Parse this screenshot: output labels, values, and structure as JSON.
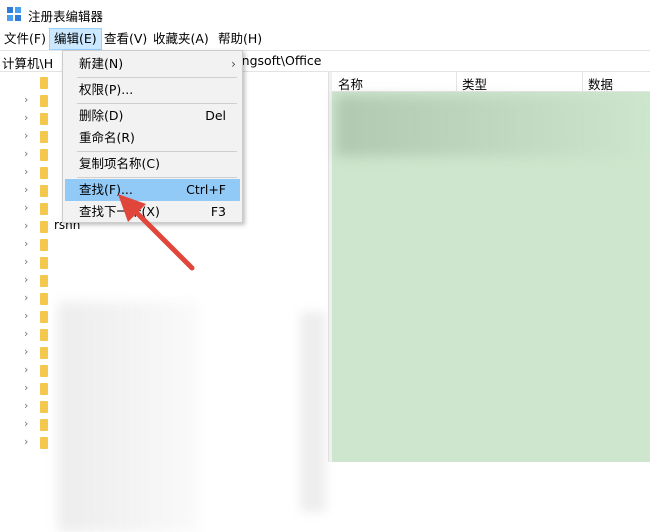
{
  "window": {
    "title": "注册表编辑器",
    "icon": "registry-editor-icon"
  },
  "menubar": {
    "items": [
      {
        "label": "文件(F)"
      },
      {
        "label": "编辑(E)"
      },
      {
        "label": "查看(V)"
      },
      {
        "label": "收藏夹(A)"
      },
      {
        "label": "帮助(H)"
      }
    ]
  },
  "address": {
    "left": "计算机\\H",
    "right": "Kingsoft\\Office"
  },
  "tree": {
    "visible_label": "rsnn"
  },
  "list": {
    "columns": [
      {
        "label": "名称"
      },
      {
        "label": "类型"
      },
      {
        "label": "数据"
      }
    ]
  },
  "edit_menu": {
    "items": [
      {
        "label": "新建(N)",
        "shortcut": "",
        "submenu": true
      },
      {
        "label": "权限(P)...",
        "shortcut": ""
      },
      {
        "label": "删除(D)",
        "shortcut": "Del"
      },
      {
        "label": "重命名(R)",
        "shortcut": ""
      },
      {
        "label": "复制项名称(C)",
        "shortcut": ""
      },
      {
        "label": "查找(F)...",
        "shortcut": "Ctrl+F",
        "highlighted": true
      },
      {
        "label": "查找下一个(X)",
        "shortcut": "F3"
      }
    ],
    "submenu_glyph": "›"
  },
  "colors": {
    "menu_highlight": "#91c9f7",
    "menu_active": "#cce8ff",
    "list_background": "#cde6cd",
    "folder": "#f4c84c",
    "annotation_arrow": "#e0463a"
  }
}
